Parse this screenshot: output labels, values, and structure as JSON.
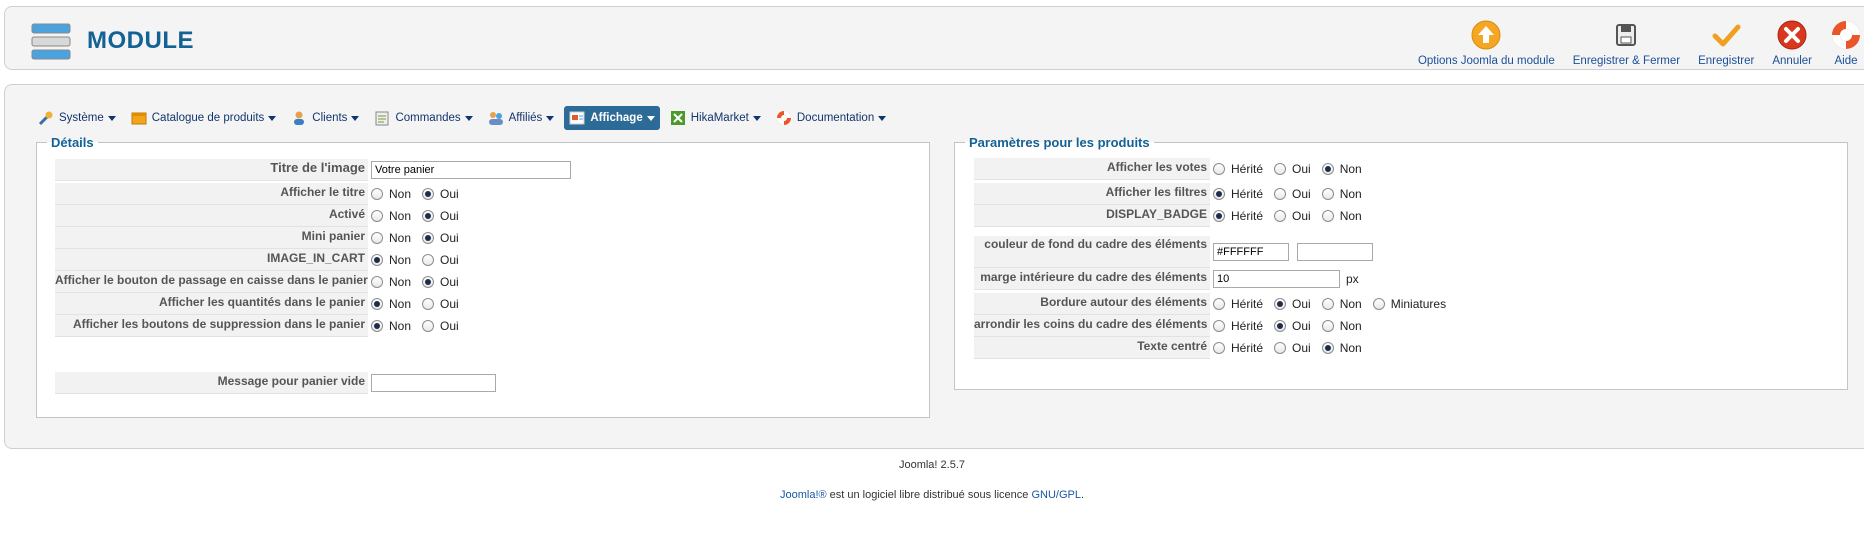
{
  "header": {
    "title": "MODULE",
    "toolbar": [
      {
        "label": "Options Joomla du module",
        "icon": "options-up-arrow-icon"
      },
      {
        "label": "Enregistrer & Fermer",
        "icon": "save-disk-icon"
      },
      {
        "label": "Enregistrer",
        "icon": "save-checkmark-icon"
      },
      {
        "label": "Annuler",
        "icon": "cancel-x-icon"
      },
      {
        "label": "Aide",
        "icon": "help-lifebuoy-icon"
      }
    ]
  },
  "menu": [
    {
      "label": "Système",
      "icon": "tools-icon"
    },
    {
      "label": "Catalogue de produits",
      "icon": "catalog-icon"
    },
    {
      "label": "Clients",
      "icon": "clients-icon"
    },
    {
      "label": "Commandes",
      "icon": "orders-icon"
    },
    {
      "label": "Affiliés",
      "icon": "affiliates-icon"
    },
    {
      "label": "Affichage",
      "icon": "display-icon",
      "active": true
    },
    {
      "label": "HikaMarket",
      "icon": "hikamarket-icon"
    },
    {
      "label": "Documentation",
      "icon": "documentation-lifebuoy-icon"
    }
  ],
  "details": {
    "legend": "Détails",
    "image_title": {
      "label": "Titre de l'image",
      "value": "Votre panier"
    },
    "rows": [
      {
        "label": "Afficher le titre",
        "options": [
          "Non",
          "Oui"
        ],
        "selected": 1
      },
      {
        "label": "Activé",
        "options": [
          "Non",
          "Oui"
        ],
        "selected": 1
      },
      {
        "label": "Mini panier",
        "options": [
          "Non",
          "Oui"
        ],
        "selected": 1
      },
      {
        "label": "IMAGE_IN_CART",
        "options": [
          "Non",
          "Oui"
        ],
        "selected": 0
      },
      {
        "label": "Afficher le bouton de passage en caisse dans le panier",
        "options": [
          "Non",
          "Oui"
        ],
        "selected": 1
      },
      {
        "label": "Afficher les quantités dans le panier",
        "options": [
          "Non",
          "Oui"
        ],
        "selected": 0
      },
      {
        "label": "Afficher les boutons de suppression dans le panier",
        "options": [
          "Non",
          "Oui"
        ],
        "selected": 0
      }
    ],
    "empty_message": {
      "label": "Message pour panier vide",
      "value": ""
    }
  },
  "product_params": {
    "legend": "Paramètres pour les produits",
    "rows_top": [
      {
        "label": "Afficher les votes",
        "options": [
          "Hérité",
          "Oui",
          "Non"
        ],
        "selected": 2
      },
      {
        "label": "Afficher les filtres",
        "options": [
          "Hérité",
          "Oui",
          "Non"
        ],
        "selected": 0
      },
      {
        "label": "DISPLAY_BADGE",
        "options": [
          "Hérité",
          "Oui",
          "Non"
        ],
        "selected": 0
      }
    ],
    "bg_color": {
      "label": "couleur de fond du cadre des éléments",
      "value": "#FFFFFF",
      "value2": ""
    },
    "padding": {
      "label": "marge intérieure du cadre des éléments",
      "value": "10",
      "unit": "px"
    },
    "border": {
      "label": "Bordure autour des éléments",
      "options": [
        "Hérité",
        "Oui",
        "Non",
        "Miniatures"
      ],
      "selected": 1
    },
    "rounded": {
      "label": "arrondir les coins du cadre des éléments",
      "options": [
        "Hérité",
        "Oui",
        "Non"
      ],
      "selected": 1
    },
    "centered": {
      "label": "Texte centré",
      "options": [
        "Hérité",
        "Oui",
        "Non"
      ],
      "selected": 2
    }
  },
  "footer": {
    "version": "Joomla! 2.5.7",
    "license_link1": "Joomla!®",
    "license_text": " est un logiciel libre distribué sous licence ",
    "license_link2": "GNU/GPL",
    "license_end": "."
  }
}
